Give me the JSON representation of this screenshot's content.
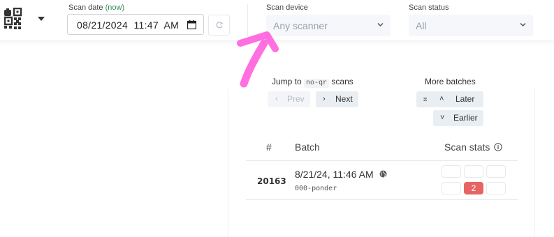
{
  "header": {
    "logo": "qr-code-logo",
    "scan_date": {
      "label": "Scan date",
      "now_link": "(now)",
      "value": "08/21/2024  11:47  AM"
    },
    "scan_device": {
      "label": "Scan device",
      "value": "Any scanner"
    },
    "scan_status": {
      "label": "Scan status",
      "value": "All"
    }
  },
  "jump": {
    "prefix": "Jump to",
    "code": "no-qr",
    "suffix": "scans",
    "prev": "Prev",
    "next": "Next"
  },
  "batches": {
    "title": "More batches",
    "later": "Later",
    "earlier": "Earlier"
  },
  "table": {
    "col_num": "#",
    "col_batch": "Batch",
    "col_stats": "Scan stats",
    "rows": [
      {
        "id": "20163",
        "time": "8/21/24, 11:46 AM",
        "device": "000-ponder",
        "badge": "2"
      }
    ]
  },
  "colors": {
    "accent": "#2e8b57",
    "badge_red": "#e76464",
    "arrow_pink": "#ff6fe0"
  }
}
